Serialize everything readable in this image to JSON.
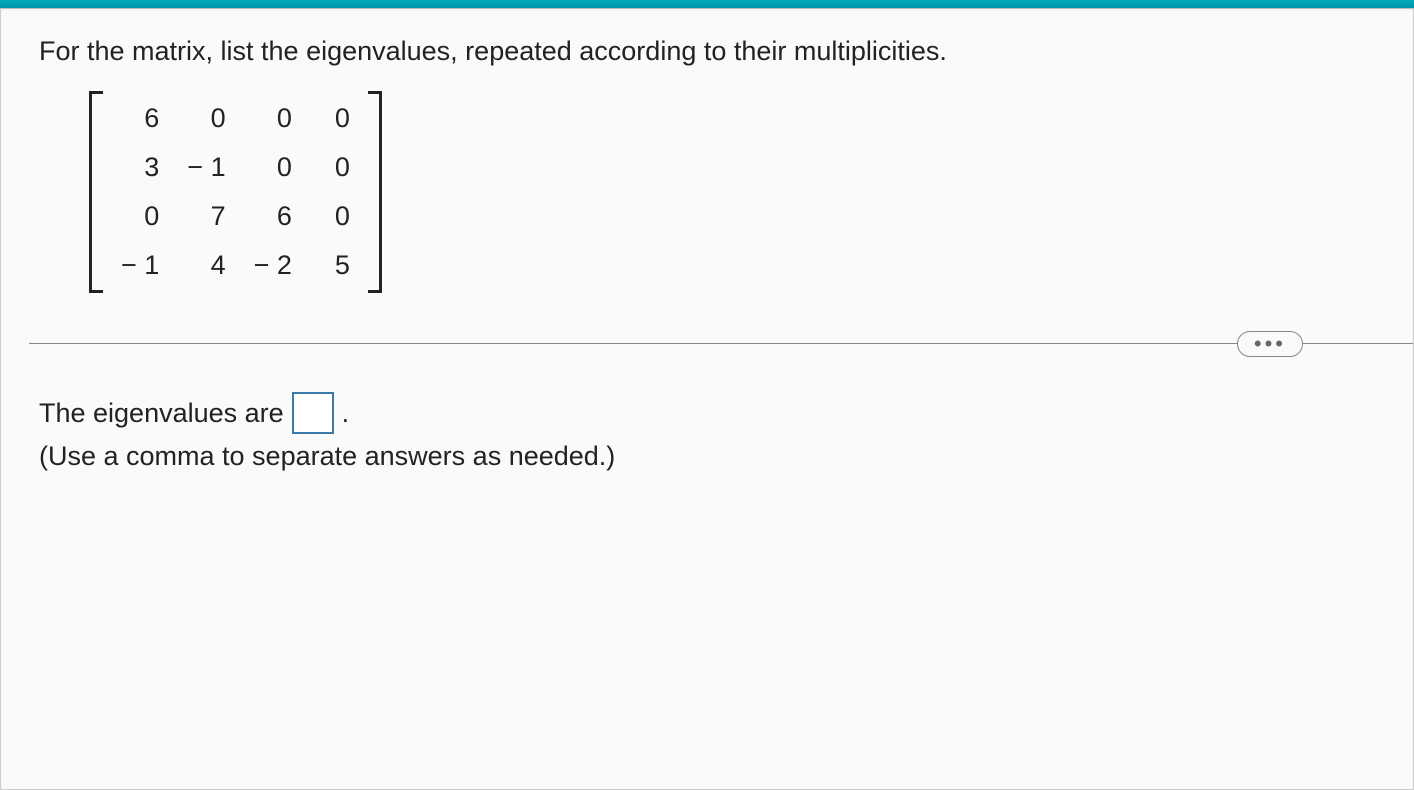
{
  "question": {
    "prompt": "For the matrix, list the eigenvalues, repeated according to their multiplicities.",
    "matrix": {
      "rows": [
        [
          "6",
          "0",
          "0",
          "0"
        ],
        [
          "3",
          "− 1",
          "0",
          "0"
        ],
        [
          "0",
          "7",
          "6",
          "0"
        ],
        [
          "− 1",
          "4",
          "− 2",
          "5"
        ]
      ]
    }
  },
  "answer": {
    "prefix": "The eigenvalues are",
    "input_value": "",
    "suffix": ".",
    "hint": "(Use a comma to separate answers as needed.)"
  },
  "more_button": "•••"
}
